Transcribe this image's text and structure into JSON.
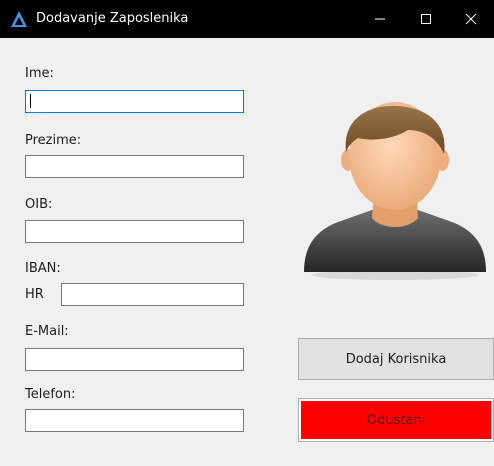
{
  "window": {
    "title": "Dodavanje Zaposlenika",
    "controls": {
      "minimize": "minimize-icon",
      "maximize": "maximize-icon",
      "close": "close-icon"
    }
  },
  "form": {
    "ime_label": "Ime:",
    "ime_value": "",
    "prezime_label": "Prezime:",
    "prezime_value": "",
    "oib_label": "OIB:",
    "oib_value": "",
    "iban_label": "IBAN:",
    "iban_prefix": "HR",
    "iban_value": "",
    "email_label": "E-Mail:",
    "email_value": "",
    "telefon_label": "Telefon:",
    "telefon_value": ""
  },
  "avatar": {
    "icon": "user-avatar-icon"
  },
  "buttons": {
    "add_label": "Dodaj Korisnika",
    "cancel_label": "Odustani"
  },
  "colors": {
    "titlebar": "#000000",
    "window_bg": "#f0f0f0",
    "focus_border": "#0078d7",
    "cancel_bg": "#ff0000",
    "cancel_text": "#5a0000",
    "app_icon": "#4a90e2"
  }
}
